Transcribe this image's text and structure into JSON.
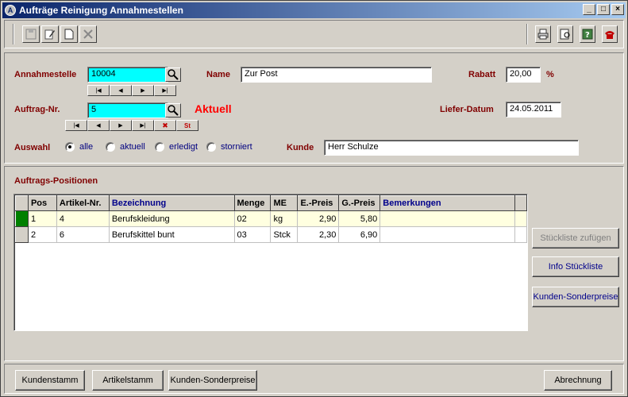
{
  "window": {
    "title": "Aufträge Reinigung Annahmestellen"
  },
  "form": {
    "annahmestelle_label": "Annahmestelle",
    "annahmestelle_value": "10004",
    "name_label": "Name",
    "name_value": "Zur Post",
    "rabatt_label": "Rabatt",
    "rabatt_value": "20,00",
    "rabatt_unit": "%",
    "auftrag_label": "Auftrag-Nr.",
    "auftrag_value": "5",
    "status_text": "Aktuell",
    "liefer_label": "Liefer-Datum",
    "liefer_value": "24.05.2011",
    "auswahl_label": "Auswahl",
    "options": [
      "alle",
      "aktuell",
      "erledigt",
      "storniert"
    ],
    "kunde_label": "Kunde",
    "kunde_value": "Herr Schulze",
    "nav2_delete": "✖",
    "nav2_st": "St"
  },
  "positions": {
    "title": "Auftrags-Positionen",
    "columns": [
      "Pos",
      "Artikel-Nr.",
      "Bezeichnung",
      "Menge",
      "ME",
      "E.-Preis",
      "G.-Preis",
      "Bemerkungen"
    ],
    "rows": [
      [
        "1",
        "4",
        "Berufskleidung",
        "02",
        "kg",
        "2,90",
        "5,80",
        ""
      ],
      [
        "2",
        "6",
        "Berufskittel bunt",
        "03",
        "Stck",
        "2,30",
        "6,90",
        ""
      ]
    ]
  },
  "side_buttons": {
    "stueckliste_zufuegen": "Stückliste zufügen",
    "info_stueckliste": "Info Stückliste",
    "kunden_sonderpreise": "Kunden-Sonderpreise"
  },
  "bottom_buttons": {
    "kundenstamm": "Kundenstamm",
    "artikelstamm": "Artikelstamm",
    "kunden_sonderpreise": "Kunden-Sonderpreise",
    "abrechnung": "Abrechnung"
  },
  "colors": {
    "title_bar": "#0a246a",
    "label": "#800000",
    "status": "#ff0000",
    "highlight": "#00ffff"
  }
}
